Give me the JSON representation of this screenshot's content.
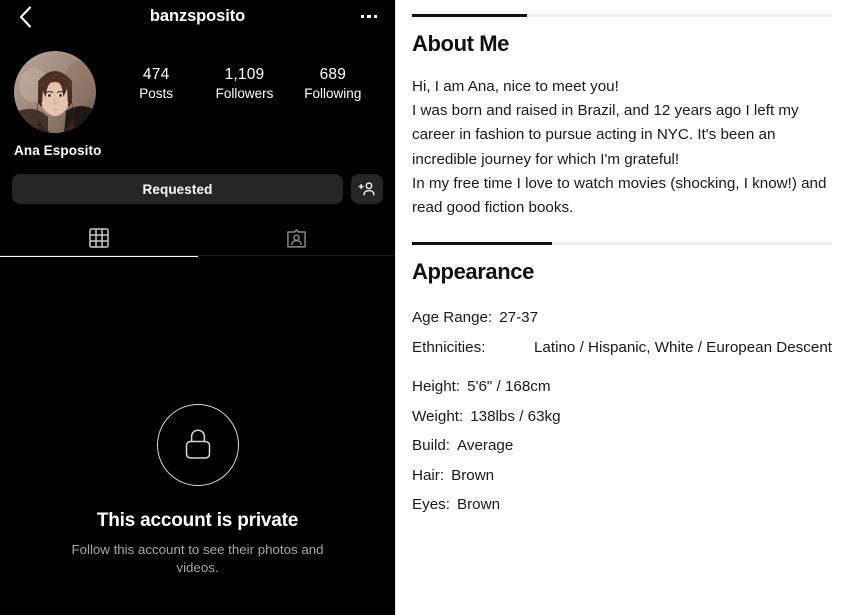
{
  "profile": {
    "username": "banzsposito",
    "full_name": "Ana Esposito",
    "back_icon": "chevron-left-icon",
    "more_icon": "more-options-icon",
    "stats": [
      {
        "num": "474",
        "label": "Posts"
      },
      {
        "num": "1,109",
        "label": "Followers"
      },
      {
        "num": "689",
        "label": "Following"
      }
    ],
    "primary_action": "Requested",
    "add_user_icon": "add-person-icon",
    "tabs": [
      {
        "icon": "grid-icon",
        "active": true
      },
      {
        "icon": "tagged-photos-icon",
        "active": false
      }
    ],
    "private": {
      "lock_icon": "lock-icon",
      "title": "This account is private",
      "subtitle": "Follow this account to see their photos and videos."
    }
  },
  "about": {
    "title": "About Me",
    "lines": [
      "Hi, I am Ana, nice to meet you!",
      "I was born and raised in Brazil, and 12 years ago I left my career in fashion to pursue acting in NYC. It's been an incredible journey for which I'm grateful!",
      "In my free time I love to watch movies (shocking, I know!) and read good fiction books."
    ]
  },
  "appearance": {
    "title": "Appearance",
    "rows": [
      {
        "key": "Age Range:",
        "value": "27-37",
        "inline": true
      },
      {
        "key": "Ethnicities:",
        "value": "Latino / Hispanic, White / European Descent",
        "inline": false
      },
      {
        "key": "Height:",
        "value": "5'6\" / 168cm",
        "inline": true
      },
      {
        "key": "Weight:",
        "value": "138lbs / 63kg",
        "inline": true
      },
      {
        "key": "Build:",
        "value": "Average",
        "inline": true
      },
      {
        "key": "Hair:",
        "value": "Brown",
        "inline": true
      },
      {
        "key": "Eyes:",
        "value": "Brown",
        "inline": true
      }
    ]
  },
  "colors": {
    "panel_bg": "#000000",
    "panel_text": "#ffffff",
    "button_bg": "#262626",
    "muted_text": "#a8a8a8",
    "accent_rule": "#111111",
    "rule_bg": "#efefef"
  }
}
